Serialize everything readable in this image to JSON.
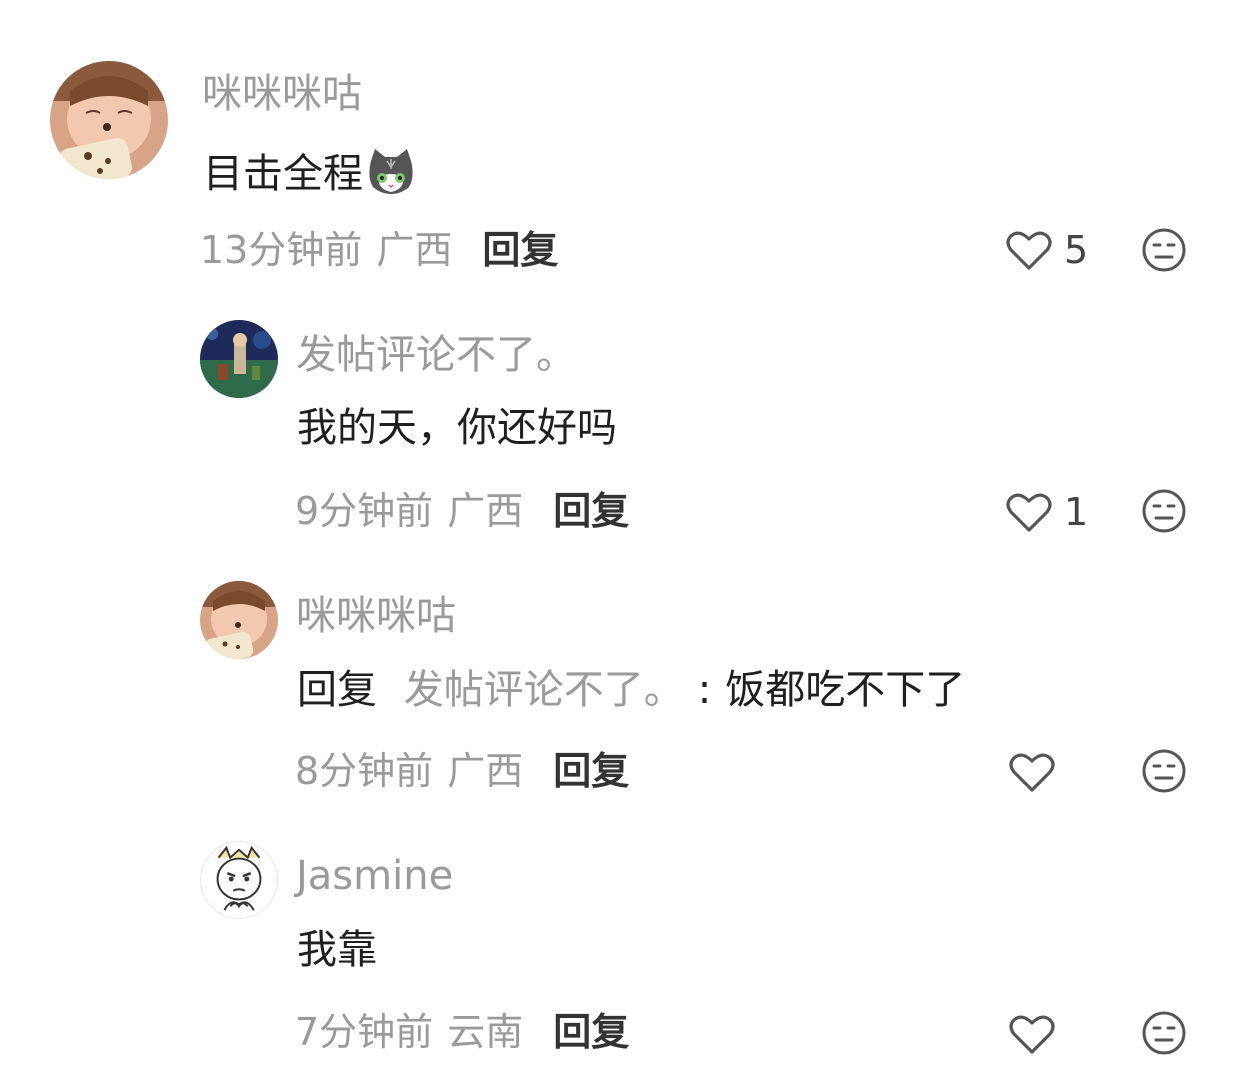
{
  "comments": [
    {
      "username": "咪咪咪咕",
      "text": "目击全程",
      "emoji": "cat-face-emoji",
      "time": "13分钟前",
      "location": "广西",
      "reply_label": "回复",
      "like_count": "5",
      "avatar": "girl-avatar"
    },
    {
      "username": "发帖评论不了。",
      "text": "我的天，你还好吗",
      "time": "9分钟前",
      "location": "广西",
      "reply_label": "回复",
      "like_count": "1",
      "avatar": "night-scene-avatar"
    },
    {
      "username": "咪咪咪咕",
      "reply_prefix": "回复",
      "reply_target": "发帖评论不了。",
      "separator": ":",
      "text": "饭都吃不下了",
      "time": "8分钟前",
      "location": "广西",
      "reply_label": "回复",
      "like_count": "",
      "avatar": "girl-avatar"
    },
    {
      "username": "Jasmine",
      "text": "我靠",
      "time": "7分钟前",
      "location": "云南",
      "reply_label": "回复",
      "like_count": "",
      "avatar": "cartoon-avatar"
    }
  ],
  "icons": {
    "like": "heart-outline-icon",
    "react": "meh-face-icon"
  },
  "colors": {
    "username": "#9a9a9a",
    "text": "#1f1f1f",
    "meta": "#9a9a9a",
    "reply": "#333333"
  }
}
